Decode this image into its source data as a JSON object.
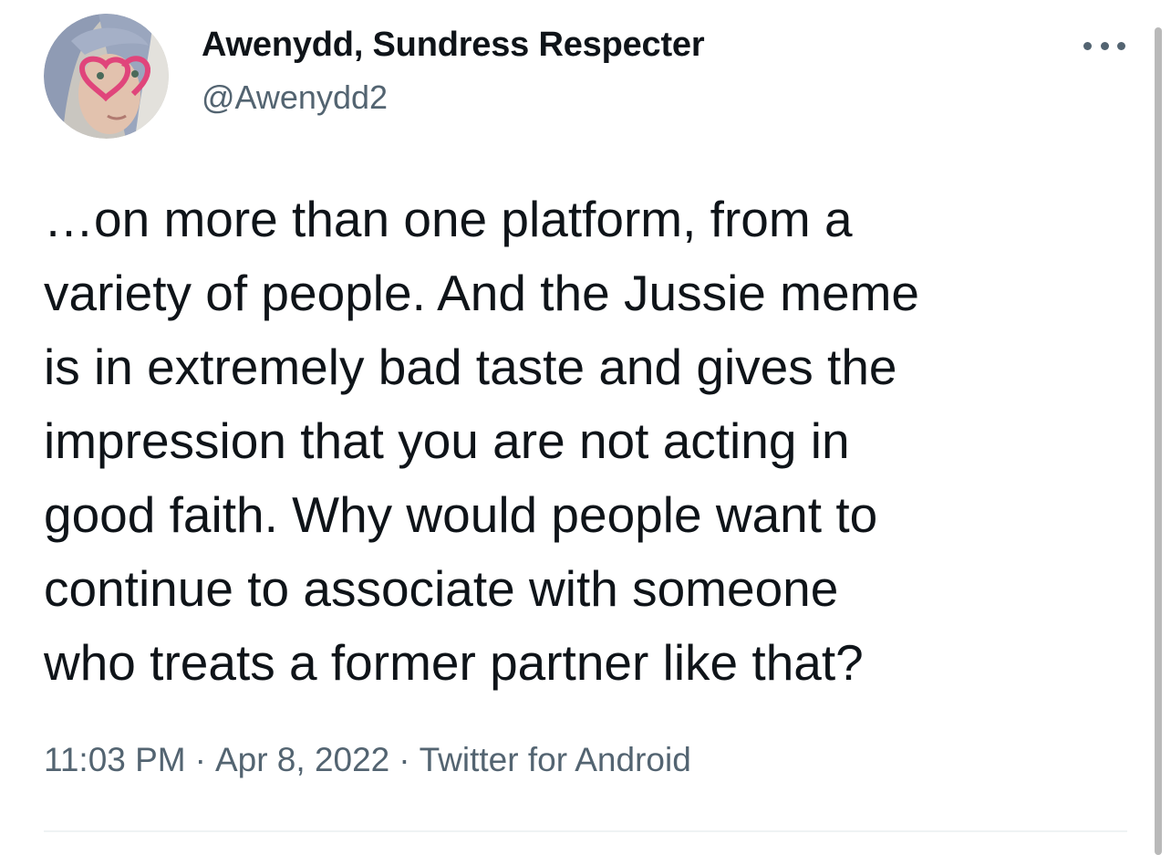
{
  "author": {
    "display_name": "Awenydd, Sundress Respecter",
    "handle": "@Awenydd2",
    "avatar_icon": "avatar-photo"
  },
  "tweet": {
    "text_lines": [
      "…on more than one platform, from a",
      "variety of people. And the Jussie meme",
      "is in extremely bad taste and gives the",
      "impression that you are not acting in",
      "good faith. Why would people want to",
      "continue to associate with someone",
      "who treats a former partner like that?"
    ],
    "time": "11:03 PM",
    "date": "Apr 8, 2022",
    "source": "Twitter for Android",
    "separator": "·"
  },
  "icons": {
    "more": "more-horizontal-icon"
  },
  "colors": {
    "text": "#0f1419",
    "secondary": "#536471",
    "divider": "#eff3f4"
  }
}
